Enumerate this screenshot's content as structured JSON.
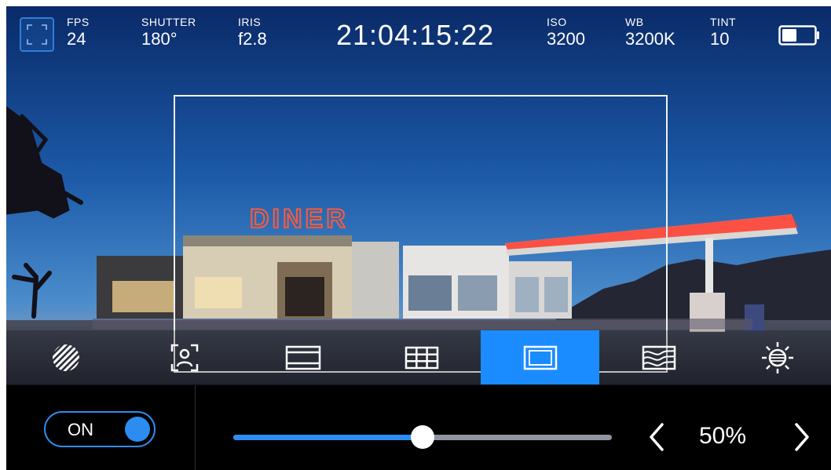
{
  "status_bar": {
    "fps": {
      "label": "FPS",
      "value": "24"
    },
    "shutter": {
      "label": "SHUTTER",
      "value": "180°"
    },
    "iris": {
      "label": "IRIS",
      "value": "f2.8"
    },
    "timecode": "21:04:15:22",
    "iso": {
      "label": "ISO",
      "value": "3200"
    },
    "wb": {
      "label": "WB",
      "value": "3200K"
    },
    "tint": {
      "label": "TINT",
      "value": "10"
    },
    "battery_level": 0.45,
    "frame_icon": "frame-guides-icon"
  },
  "scene": {
    "sign_text": "DINER",
    "description_icon": "background-photo"
  },
  "tools": [
    {
      "icon": "zebra-icon",
      "active": false
    },
    {
      "icon": "focus-assist-icon",
      "active": false
    },
    {
      "icon": "frame-guides-icon",
      "active": false
    },
    {
      "icon": "grid-icon",
      "active": false
    },
    {
      "icon": "safe-area-icon",
      "active": true
    },
    {
      "icon": "false-color-icon",
      "active": false
    },
    {
      "icon": "exposure-icon",
      "active": false
    }
  ],
  "panel": {
    "toggle_label": "ON",
    "toggle_on": true,
    "slider_fraction": 0.5,
    "value_text": "50%"
  },
  "colors": {
    "accent": "#1a8cff",
    "track": "#8f95a0",
    "panel_bg": "#000000"
  }
}
